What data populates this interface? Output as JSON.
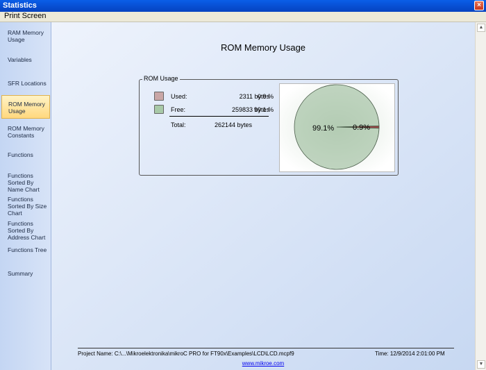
{
  "window": {
    "title": "Statistics",
    "close_glyph": "×"
  },
  "menu": {
    "print_screen": "Print Screen"
  },
  "sidebar": {
    "items": [
      {
        "label": "RAM Memory Usage",
        "active": false
      },
      {
        "label": "Variables",
        "active": false
      },
      {
        "label": "SFR Locations",
        "active": false
      },
      {
        "label": "ROM Memory Usage",
        "active": true
      },
      {
        "label": "ROM Memory Constants",
        "active": false
      },
      {
        "label": "Functions",
        "active": false
      },
      {
        "label": "Functions Sorted By Name Chart",
        "active": false
      },
      {
        "label": "Functions Sorted By Size Chart",
        "active": false
      },
      {
        "label": "Functions Sorted By Address Chart",
        "active": false
      },
      {
        "label": "Functions Tree",
        "active": false
      },
      {
        "label": "Summary",
        "active": false
      }
    ]
  },
  "main": {
    "title": "ROM Memory  Usage",
    "group_title": "ROM Usage",
    "used": {
      "label": "Used:",
      "bytes": "2311 bytes",
      "percent": "0.9 %",
      "color": "#c9a6a6"
    },
    "free": {
      "label": "Free:",
      "bytes": "259833 bytes",
      "percent": "99.1 %",
      "color": "#a8c9a8"
    },
    "total": {
      "label": "Total:",
      "bytes": "262144 bytes"
    }
  },
  "chart_data": {
    "type": "pie",
    "slices": [
      {
        "label": "99.1%",
        "value": 99.1,
        "color": "#8fb58f"
      },
      {
        "label": "0.9%",
        "value": 0.9,
        "color": "#9b4a4a"
      }
    ]
  },
  "footer": {
    "project": "Project Name: C:\\...\\Mikroelektronika\\mikroC PRO for FT90x\\Examples\\LCD\\LCD.mcpf9",
    "time": "Time: 12/9/2014 2:01:00 PM",
    "link": "www.mikroe.com"
  },
  "scrollbar": {
    "up": "▲",
    "down": "▼"
  }
}
